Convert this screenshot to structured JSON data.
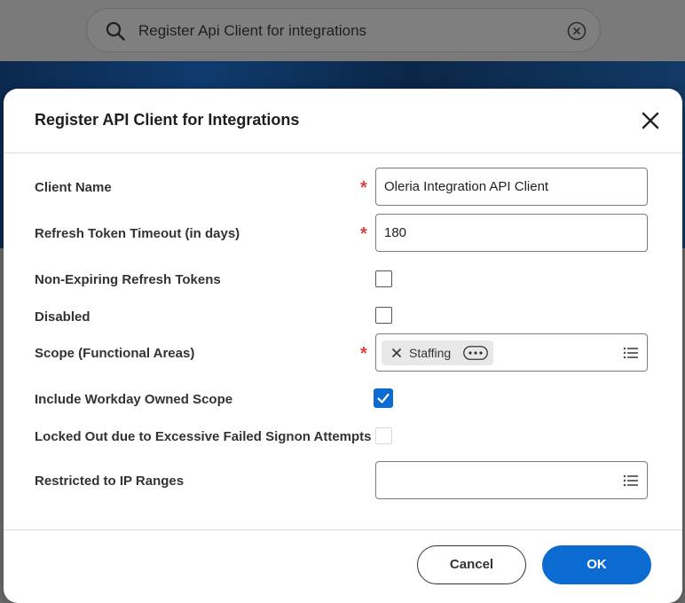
{
  "search": {
    "query": "Register Api Client for integrations"
  },
  "dialog": {
    "title": "Register API Client for Integrations",
    "fields": {
      "client_name": {
        "label": "Client Name",
        "value": "Oleria Integration API Client",
        "required": true
      },
      "refresh_timeout": {
        "label": "Refresh Token Timeout (in days)",
        "value": "180",
        "required": true
      },
      "non_expiring": {
        "label": "Non-Expiring Refresh Tokens",
        "checked": false
      },
      "disabled": {
        "label": "Disabled",
        "checked": false
      },
      "scope": {
        "label": "Scope (Functional Areas)",
        "required": true,
        "tags": [
          "Staffing"
        ]
      },
      "include_workday_scope": {
        "label": "Include Workday Owned Scope",
        "checked": true
      },
      "locked_out": {
        "label": "Locked Out due to Excessive Failed Signon Attempts",
        "checked": false,
        "enabled": false
      },
      "ip_ranges": {
        "label": "Restricted to IP Ranges",
        "value": ""
      }
    },
    "required_marker": "*",
    "buttons": {
      "cancel": "Cancel",
      "ok": "OK"
    }
  },
  "icons": {
    "search": "search-icon",
    "clear": "clear-circle-icon",
    "close": "close-icon",
    "list": "list-icon",
    "tag_remove": "remove-tag-icon",
    "more": "more-options-icon",
    "check": "checkmark-icon"
  },
  "colors": {
    "primary": "#0c6bd1",
    "required": "#de4040",
    "modal_bg": "#ffffff"
  }
}
